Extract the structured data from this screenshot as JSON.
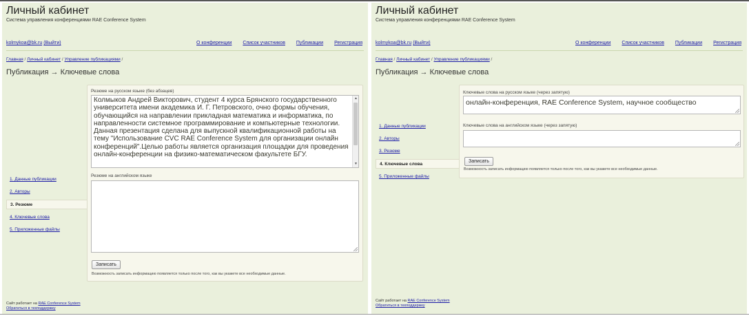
{
  "header": {
    "title": "Личный кабинет",
    "subtitle": "Система управления конференциями RAE Conference System"
  },
  "topnav": {
    "user": "kolmykoa@bk.ru",
    "logout": "(Выйти)",
    "links": [
      "О конференции",
      "Список участников",
      "Публикации",
      "Регистрация"
    ]
  },
  "breadcrumbs": {
    "home": "Главная",
    "cabinet": "Личный кабинет",
    "manage": "Управление публикациями",
    "sep": " / "
  },
  "steps": [
    "1. Данные публикации",
    "2. Авторы",
    "3. Резюме",
    "4. Ключевые слова",
    "5. Приложенные файлы"
  ],
  "footer": {
    "line1_prefix": "Сайт работает на ",
    "line1_link": "RAE Conference System",
    "line2_link": "Обратиться в техподдержку"
  },
  "left": {
    "page_title": "Публикация → Ключевые слова",
    "active_step": 2,
    "ru_label": "Резюме на русском языке (без абзацев)",
    "ru_value": "Колмыков Андрей Викторович, студент 4 курса Брянского государственного университета имени академика И. Г. Петровского, очно формы обучения, обучающийся на направлении прикладная математика и информатика, по направленности системное программирование и компьютерные технологии. Данная презентация сделана для выпускной квалификационной работы на тему \"Использование CVC RAE Conference System для организации онлайн конференций\".Целью работы является организация площадки для проведения онлайн-конференции на физико-математическом факультете БГУ.",
    "en_label": "Резюме на английском языке",
    "en_value": "",
    "save": "Записать",
    "note": "Возможность записать информацию появляется только после того, как вы укажете все необходимые данные."
  },
  "right": {
    "page_title": "Публикация → Ключевые слова",
    "active_step": 3,
    "ru_label": "Ключевые слова на русском языке (через запятую)",
    "ru_value": "онлайн-конференция, RAE Conference System, научное сообщество",
    "en_label": "Ключевые слова на английском языке (через запятую)",
    "en_value": "",
    "save": "Записать",
    "note": "Возможность записать информацию появляется только после того, как вы укажете все необходимые данные."
  }
}
